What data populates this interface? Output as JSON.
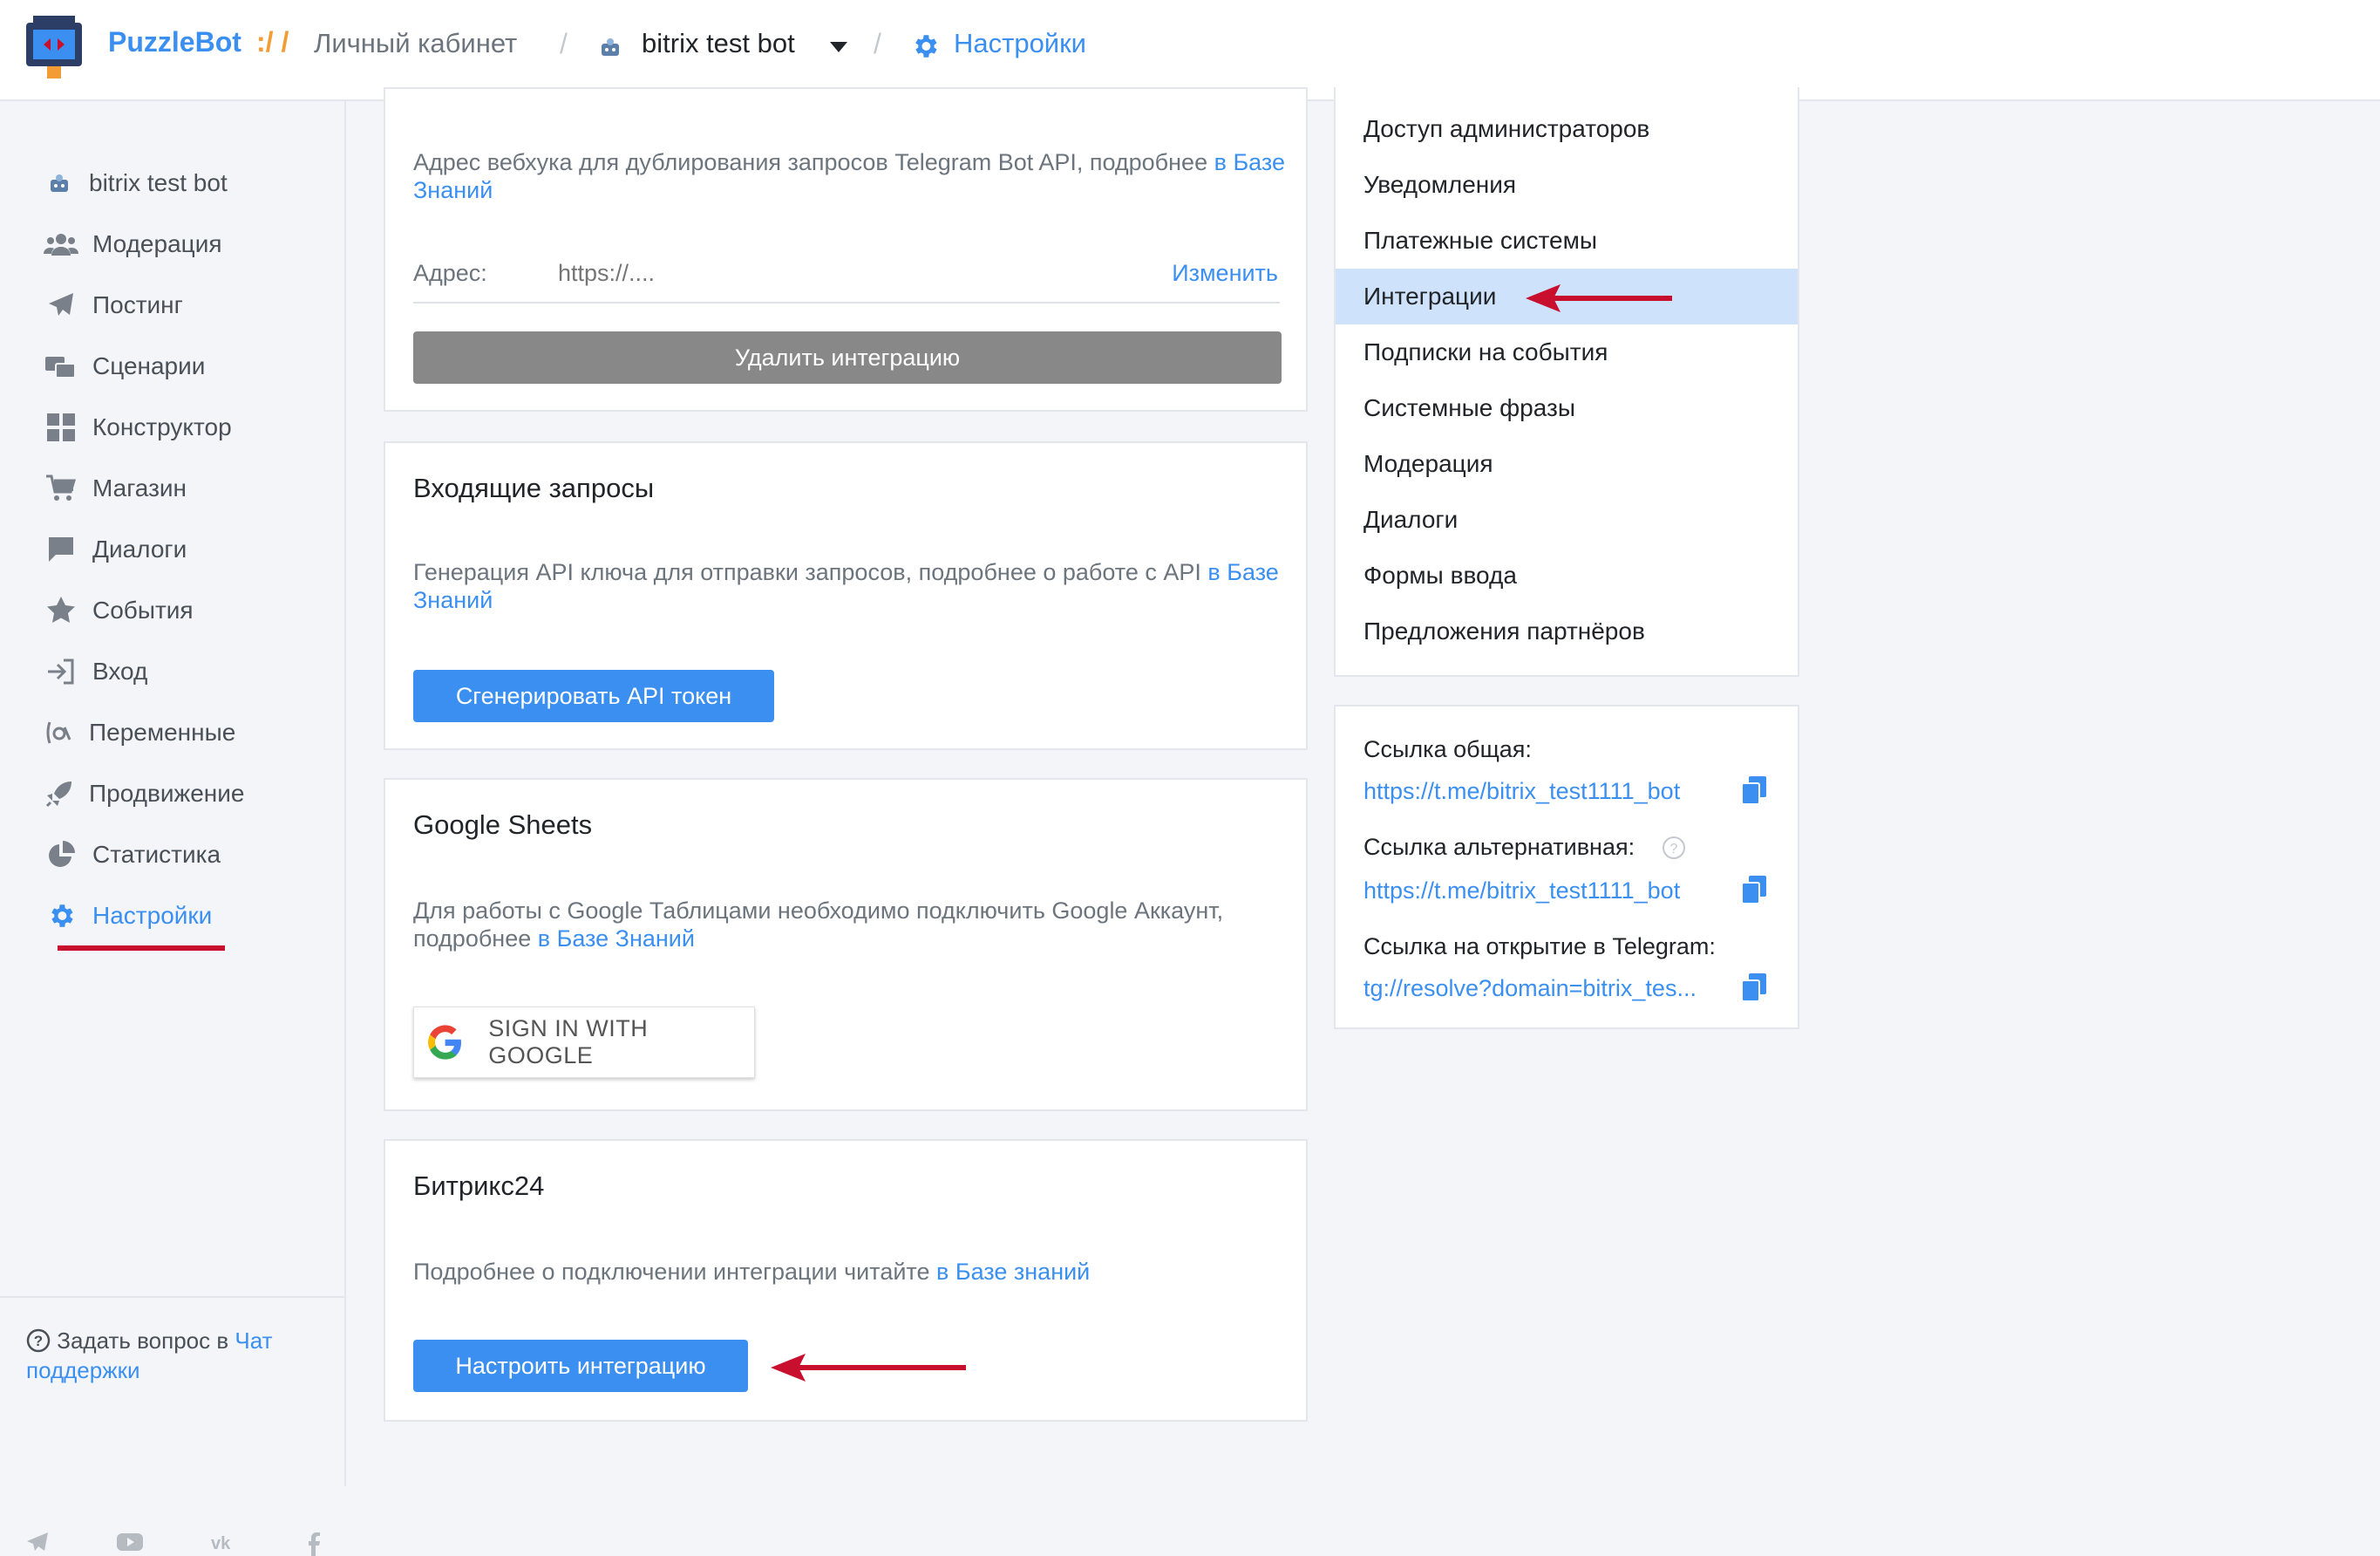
{
  "header": {
    "brand": "PuzzleBot",
    "brand_sep": ":/ /",
    "cabinet": "Личный кабинет",
    "slash": "/",
    "bot_name": "bitrix test bot",
    "settings": "Настройки"
  },
  "sidebar": {
    "bot_name": "bitrix test bot",
    "items": [
      {
        "label": "Модерация",
        "icon": "users-icon"
      },
      {
        "label": "Постинг",
        "icon": "paper-plane-icon"
      },
      {
        "label": "Сценарии",
        "icon": "scenarios-icon"
      },
      {
        "label": "Конструктор",
        "icon": "grid-icon"
      },
      {
        "label": "Магазин",
        "icon": "cart-icon"
      },
      {
        "label": "Диалоги",
        "icon": "chat-icon"
      },
      {
        "label": "События",
        "icon": "star-icon"
      },
      {
        "label": "Вход",
        "icon": "sign-in-icon"
      },
      {
        "label": "Переменные",
        "icon": "variable-icon"
      },
      {
        "label": "Продвижение",
        "icon": "rocket-icon"
      },
      {
        "label": "Статистика",
        "icon": "pie-chart-icon"
      },
      {
        "label": "Настройки",
        "icon": "gear-icon"
      }
    ],
    "help_text": "Задать вопрос в",
    "help_link": "Чат поддержки"
  },
  "webhook_card": {
    "text": "Адрес вебхука для дублирования запросов Telegram Bot API, подробнее",
    "link": "в Базе Знаний",
    "address_label": "Адрес:",
    "address_placeholder": "https://....",
    "change": "Изменить",
    "delete_button": "Удалить интеграцию"
  },
  "incoming_card": {
    "title": "Входящие запросы",
    "text": "Генерация API ключа для отправки запросов, подробнее о работе с API",
    "link": "в Базе Знаний",
    "button": "Сгенерировать API токен"
  },
  "sheets_card": {
    "title": "Google Sheets",
    "text": "Для работы с Google Таблицами необходимо подключить Google Аккаунт, подробнее",
    "link": "в Базе Знаний",
    "button": "SIGN IN WITH GOOGLE"
  },
  "bitrix_card": {
    "title": "Битрикс24",
    "text": "Подробнее о подключении интеграции читайте",
    "link": "в Базе знаний",
    "button": "Настроить интеграцию"
  },
  "settings_menu": {
    "items": [
      "Доступ администраторов",
      "Уведомления",
      "Платежные системы",
      "Интеграции",
      "Подписки на события",
      "Системные фразы",
      "Модерация",
      "Диалоги",
      "Формы ввода",
      "Предложения партнёров"
    ],
    "active": "Интеграции"
  },
  "links_card": {
    "general_label": "Ссылка общая:",
    "general_url": "https://t.me/bitrix_test1111_bot",
    "alt_label": "Ссылка альтернативная:",
    "alt_url": "https://t.me/bitrix_test1111_bot",
    "tg_label": "Ссылка на открытие в Telegram:",
    "tg_url": "tg://resolve?domain=bitrix_tes..."
  },
  "colors": {
    "accent": "#3a8ff0",
    "annotation_red": "#c8102e",
    "active_menu_bg": "#cfe2fb"
  }
}
